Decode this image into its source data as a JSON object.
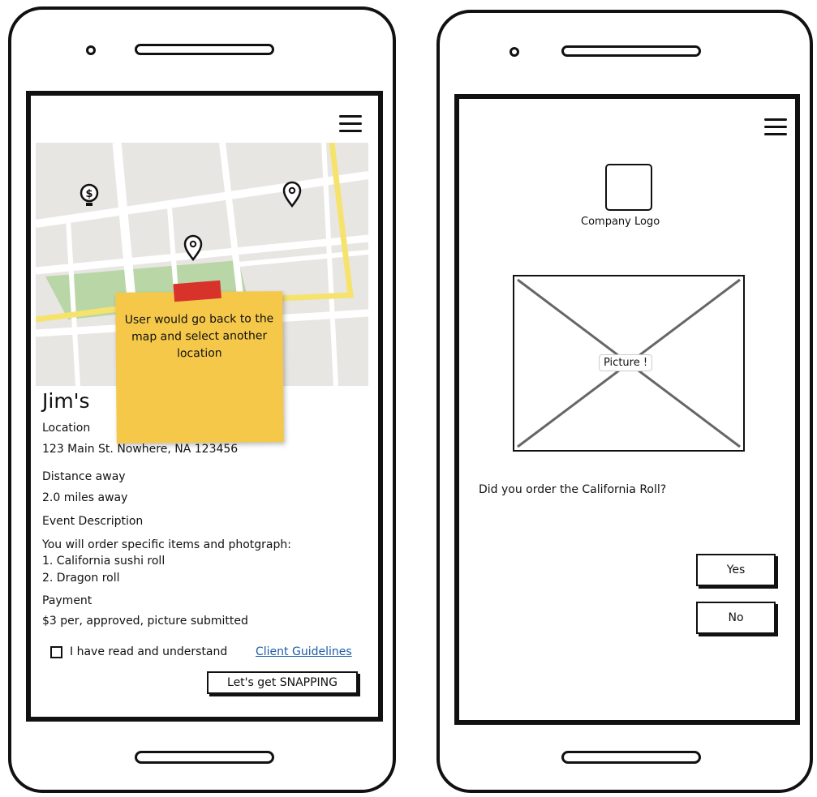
{
  "left_screen": {
    "map": {
      "pins": [
        "dollar-pin-icon",
        "location-pin-icon",
        "location-pin-icon"
      ],
      "colors": {
        "ground": "#e8e6e2",
        "road": "#ffffff",
        "park": "#b9d6a6",
        "highway": "#f6e36e"
      }
    },
    "sticky_note": {
      "text": "User would go back to the map and select another location",
      "color": "#f5c84a",
      "tape_color": "#d8332b"
    },
    "business_name": "Jim's",
    "location_label": "Location",
    "location_value": "123 Main St. Nowhere, NA 123456",
    "distance_label": "Distance away",
    "distance_value": "2.0 miles away",
    "event_label": "Event Description",
    "event_intro": "You will order specific items and photgraph:",
    "event_items": [
      "1. California sushi roll",
      "2. Dragon roll"
    ],
    "payment_label": "Payment",
    "payment_value": "$3 per, approved, picture submitted",
    "agreement_text": "I have read and understand",
    "agreement_link": "Client Guidelines",
    "submit_label": "Let's get SNAPPING"
  },
  "right_screen": {
    "logo_caption": "Company Logo",
    "picture_label": "Picture !",
    "question": "Did you order the California Roll?",
    "yes_label": "Yes",
    "no_label": "No"
  }
}
